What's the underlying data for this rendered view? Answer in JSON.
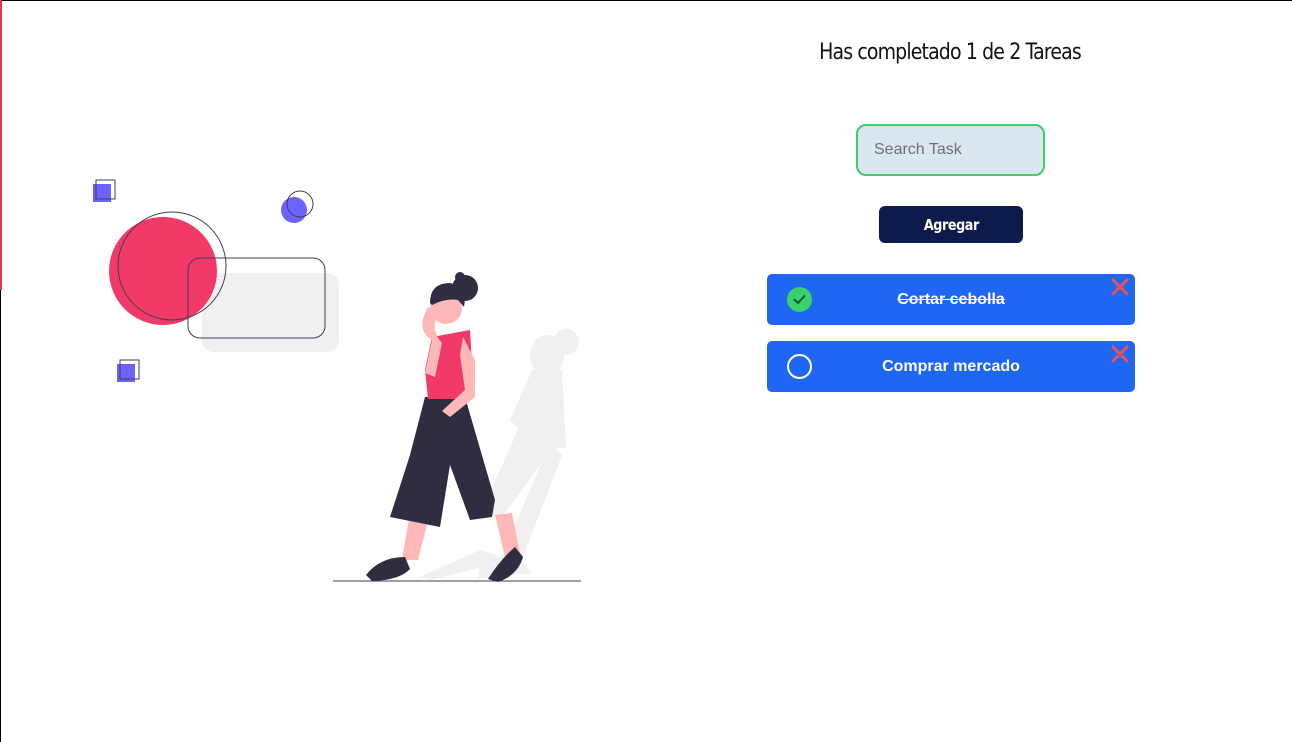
{
  "colors": {
    "background": "#ffffff",
    "accent_red": "#e13a4a",
    "task_blue": "#1f66f2",
    "button_navy": "#0d1b4c",
    "search_border_green": "#3ccf66",
    "search_fill": "#dbe6f1",
    "check_green": "#39d16b",
    "delete_red": "#e8505b",
    "illustration_pink": "#f13a68",
    "illustration_purple": "#6c63ff",
    "illustration_dark": "#2f2e41"
  },
  "header": {
    "counter_text": "Has completado 1 de 2 Tareas"
  },
  "search": {
    "value": "",
    "placeholder": "Search Task"
  },
  "add_button": {
    "label": "Agregar"
  },
  "tasks": [
    {
      "text": "Cortar cebolla",
      "completed": true,
      "toggle_icon": "check-circle-icon",
      "delete_icon": "close-icon"
    },
    {
      "text": "Comprar mercado",
      "completed": false,
      "toggle_icon": "circle-icon",
      "delete_icon": "close-icon"
    }
  ],
  "illustration": {
    "icon": "woman-walking-illustration"
  }
}
